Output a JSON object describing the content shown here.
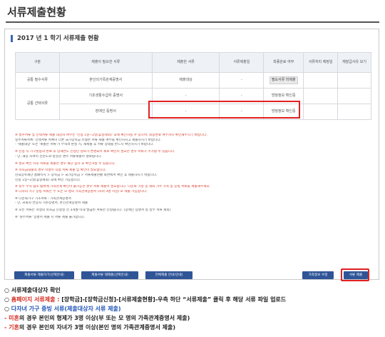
{
  "header": {
    "title": "서류제출현황"
  },
  "section": {
    "title": "2017 년 1 학기 서류제출 현황"
  },
  "table": {
    "headers": [
      "구분",
      "제출이 필요한 서류",
      "제출한 서류",
      "서류제출일",
      "최종완료 여부",
      "서류처리 예정일",
      "재발급사유 보기"
    ],
    "rows": [
      [
        "공통 필수서류",
        "본인의가족관계증명서",
        "제출대상",
        "-",
        "필요서류 미제출",
        "",
        ""
      ],
      [
        "",
        "기초생활수급자 증명서",
        "-",
        "-",
        "방청정보 확인중",
        "",
        ""
      ],
      [
        "공통 선택서류",
        "장애인 증명서",
        "-",
        "-",
        "방청정보 확인중",
        "",
        ""
      ]
    ]
  },
  "notes": [
    "※ 필수서류 및 선택서류 제출 대상자 여부는 '신청 1일~2일(휴일제외)' 후에 확인하실 수 있으며, 최종완료 여부까지 확인해주시기 바랍니다.",
    "   일주서류목록: 선택서류 목록이 다른 국가장학금 유형은 서류 제출 여부를 확인하시고 제출하시기 바랍니다.",
    "- '제출대상' 또는 '제출한 서류'가 부적격 판정 시, 재제출 후 서류 상태를 반드시 확인하시기 바랍니다.",
    "",
    "※ 신청 시 가구원동의 완료 후 당해연도 신청인 정보가 변경되어 새로 확인이 필요한 경우 서류가 추가될 수 있습니다.",
    "- 단, 해당 자격이 전년도와 동일한 경우 서류제출이 생략됩니다.",
    "",
    "※ 필요 확인 이후 서류를 제출한 경우 재단 심사 후 확인하실 수 있습니다.",
    "",
    "※ 학자금대출의 경우 학생이 직접 서류 제출 및 확인이 필요합니다.",
    "   한국장학재단 홈페이지 > 장학금 > 국가장학금 > 서류제출현황 화면에서 확인 후 제출하시기 바랍니다.",
    "   신청 1일~2일(휴일제외) 후에 확인 가능합니다.",
    "",
    "※ 정부 부처 협조 범위에 가족관계 확인이 불가능한 경우 서류 제출이 필요합니다. 다문화 가정 및 해외 거주 가족 등 증빙 서류를 제출해주세요.",
    "※ 다자녀 가구 증빙 서류는 부 또는 모 명의 가족관계증명서 (자녀 3명 이상) 로 제출 가능합니다.",
    "",
    "※ 다문화가구 기초서류 : 가족관계증명서",
    "   - 단, 귀화자 연장자 기본증명서, 혼인관계증명서 제출",
    "",
    "※ 모든 서류는 학생의 학자금 신청일 전 3개월 이내 발급된 서류만 인정됩니다. (장애인 증명서 등 일부 서류 제외)",
    "",
    "※ '원부서류' 증명서 제출 시 서류 제출 불가합니다."
  ],
  "buttons": {
    "btn1": "제출서류 제출하기(선택안내)",
    "btn2": "제출서류 재제출(선택안내)",
    "btn3": "전체제출 안내(안내)",
    "prev": "가족정보 수정",
    "submit": "서류 제출"
  },
  "annotation": {
    "line1_prefix": "○",
    "line1_text": "서류제출대상자 확인",
    "line2_prefix": "○",
    "line2_highlight": "홈페이지 서류제출 :",
    "line2_rest": " [장학금]-[장학금신청]-[서류제출현황]-우측 하단 “서류제출” 클릭 후 해당 서류 파일 업로드",
    "line3_prefix": "○",
    "line3_text": "다자녀 가구 증빙 서류(제출대상자 서류 제출)",
    "line4_highlight": "  - 미혼",
    "line4_rest": "의 경우 본인의 형제가 3명 이상(부 또는 모 명의 가족관계증명서 제출)",
    "line5_highlight": "  - 기혼",
    "line5_rest": "의 경우 본인의 자녀가 3명 이상(본인 명의 가족관계증명서 제출)"
  },
  "colors": {
    "accent_blue": "#2f5597",
    "highlight_red": "#e02020"
  }
}
